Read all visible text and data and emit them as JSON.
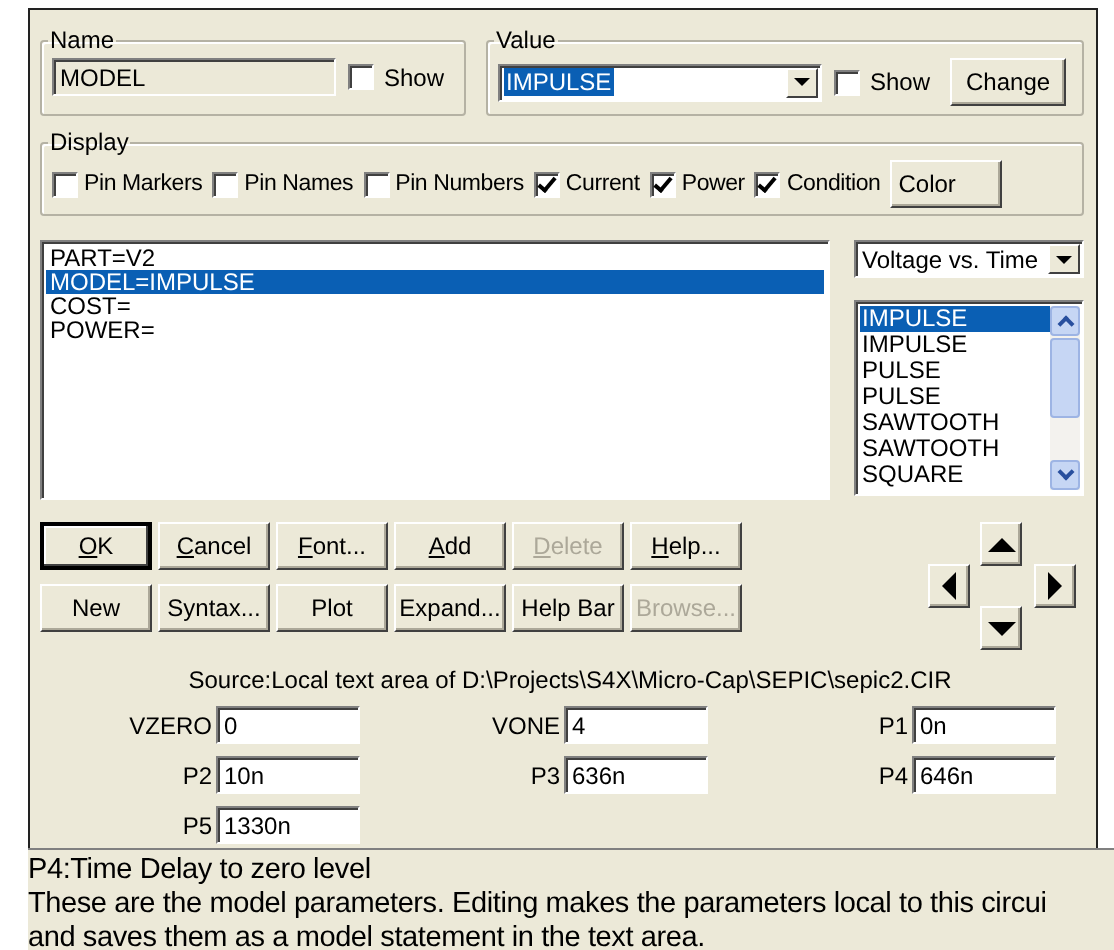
{
  "name_group": {
    "label": "Name",
    "value": "MODEL",
    "show": {
      "label": "Show",
      "checked": false
    }
  },
  "value_group": {
    "label": "Value",
    "value": "IMPULSE",
    "value_selected": true,
    "show": {
      "label": "Show",
      "checked": false
    },
    "change_button": "Change"
  },
  "display": {
    "label": "Display",
    "options": [
      {
        "label": "Pin Markers",
        "checked": false
      },
      {
        "label": "Pin Names",
        "checked": false
      },
      {
        "label": "Pin Numbers",
        "checked": false
      },
      {
        "label": "Current",
        "checked": true
      },
      {
        "label": "Power",
        "checked": true
      },
      {
        "label": "Condition",
        "checked": true
      }
    ],
    "color_button": "Color"
  },
  "text_area": [
    {
      "text": "PART=V2",
      "selected": false
    },
    {
      "text": "MODEL=IMPULSE",
      "selected": true
    },
    {
      "text": "COST=",
      "selected": false
    },
    {
      "text": "POWER=",
      "selected": false
    }
  ],
  "plot_type": "Voltage vs. Time",
  "model_list": [
    {
      "text": "IMPULSE",
      "selected": true
    },
    {
      "text": "IMPULSE",
      "selected": false
    },
    {
      "text": "PULSE",
      "selected": false
    },
    {
      "text": "PULSE",
      "selected": false
    },
    {
      "text": "SAWTOOTH",
      "selected": false
    },
    {
      "text": "SAWTOOTH",
      "selected": false
    },
    {
      "text": "SQUARE",
      "selected": false
    }
  ],
  "buttons": [
    [
      {
        "label": "OK",
        "accelerator": true,
        "default": true,
        "disabled": false
      },
      {
        "label": "Cancel",
        "accelerator": true,
        "default": false,
        "disabled": false
      },
      {
        "label": "Font...",
        "accelerator": true,
        "default": false,
        "disabled": false
      },
      {
        "label": "Add",
        "accelerator": true,
        "default": false,
        "disabled": false
      },
      {
        "label": "Delete",
        "accelerator": true,
        "default": false,
        "disabled": true
      },
      {
        "label": "Help...",
        "accelerator": true,
        "default": false,
        "disabled": false
      }
    ],
    [
      {
        "label": "New",
        "accelerator": false,
        "default": false,
        "disabled": false
      },
      {
        "label": "Syntax...",
        "accelerator": false,
        "default": false,
        "disabled": false
      },
      {
        "label": "Plot",
        "accelerator": false,
        "default": false,
        "disabled": false
      },
      {
        "label": "Expand...",
        "accelerator": false,
        "default": false,
        "disabled": false
      },
      {
        "label": "Help Bar",
        "accelerator": false,
        "default": false,
        "disabled": false
      },
      {
        "label": "Browse...",
        "accelerator": false,
        "default": false,
        "disabled": true
      }
    ]
  ],
  "source": "Source:Local text area of D:\\Projects\\S4X\\Micro-Cap\\SEPIC\\sepic2.CIR",
  "params": [
    {
      "label": "VZERO",
      "value": "0"
    },
    {
      "label": "VONE",
      "value": "4"
    },
    {
      "label": "P1",
      "value": "0n"
    },
    {
      "label": "P2",
      "value": "10n"
    },
    {
      "label": "P3",
      "value": "636n"
    },
    {
      "label": "P4",
      "value": "646n"
    },
    {
      "label": "P5",
      "value": "1330n"
    }
  ],
  "help_text": [
    "P4:Time Delay to zero level",
    "These are the model parameters. Editing makes the parameters local to this circui",
    "and saves them as a model statement in the text area."
  ]
}
